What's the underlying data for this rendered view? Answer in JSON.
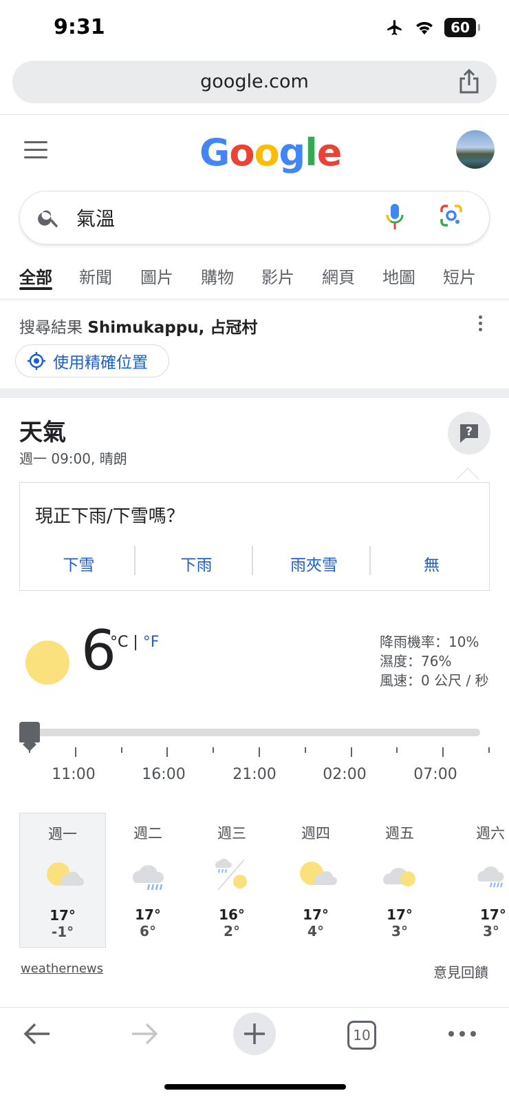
{
  "status": {
    "time": "9:31",
    "battery": "60"
  },
  "browser": {
    "url": "google.com",
    "tab_count": "10"
  },
  "google": {
    "logo": [
      "G",
      "o",
      "o",
      "g",
      "l",
      "e"
    ],
    "logo_colors": [
      "#4285F4",
      "#EA4335",
      "#FBBC05",
      "#4285F4",
      "#34A853",
      "#EA4335"
    ]
  },
  "search": {
    "query": "氣溫"
  },
  "tabs": [
    "全部",
    "新聞",
    "圖片",
    "購物",
    "影片",
    "網頁",
    "地圖",
    "短片"
  ],
  "location": {
    "prefix": "搜尋結果",
    "place": "Shimukappu, 占冠村",
    "precise_button": "使用精確位置"
  },
  "weather": {
    "title": "天氣",
    "subtitle": "週一 09:00, 晴朗",
    "survey": {
      "question": "現正下雨/下雪嗎？",
      "options": [
        "下雪",
        "下雨",
        "雨夾雪",
        "無"
      ]
    },
    "current": {
      "temp": "6",
      "unit_c": "°C",
      "sep": "|",
      "unit_f": "°F"
    },
    "details": [
      "降雨機率：10%",
      "濕度：76%",
      "風速：0 公尺 / 秒"
    ],
    "timeline": [
      "11:00",
      "16:00",
      "21:00",
      "02:00",
      "07:00"
    ],
    "forecast": [
      {
        "day": "週一",
        "icon": "partly-cloudy-icon",
        "hi": "17°",
        "lo": "-1°"
      },
      {
        "day": "週二",
        "icon": "rain-cloud-icon",
        "hi": "17°",
        "lo": "6°"
      },
      {
        "day": "週三",
        "icon": "rain-then-sun-icon",
        "hi": "16°",
        "lo": "2°"
      },
      {
        "day": "週四",
        "icon": "partly-cloudy-icon",
        "hi": "17°",
        "lo": "4°"
      },
      {
        "day": "週五",
        "icon": "mostly-cloudy-icon",
        "hi": "17°",
        "lo": "3°"
      },
      {
        "day": "週六",
        "icon": "rain-cloud-icon",
        "hi": "17°",
        "lo": "3°"
      }
    ],
    "source": "weathernews",
    "feedback": "意見回饋"
  }
}
